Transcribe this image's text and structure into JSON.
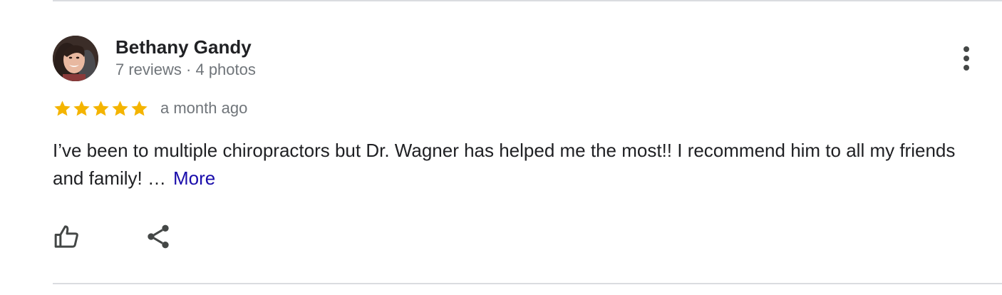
{
  "review": {
    "reviewer": {
      "name": "Bethany Gandy",
      "meta": "7 reviews · 4 photos",
      "avatar_icon": "user-photo"
    },
    "rating": {
      "stars": 5,
      "out_of": 5,
      "star_color": "#f4b400"
    },
    "date": "a month ago",
    "text": "I’ve been to multiple chiropractors but Dr. Wagner has helped me the most!! I recommend him to all my friends and family! …",
    "more_label": "More",
    "actions": {
      "like_icon": "thumbs-up-icon",
      "share_icon": "share-icon",
      "menu_icon": "more-vertical-icon"
    }
  },
  "colors": {
    "name_text": "#202124",
    "secondary_text": "#70757a",
    "link": "#1a0dab",
    "divider": "#dadce0",
    "icon": "#444746"
  }
}
